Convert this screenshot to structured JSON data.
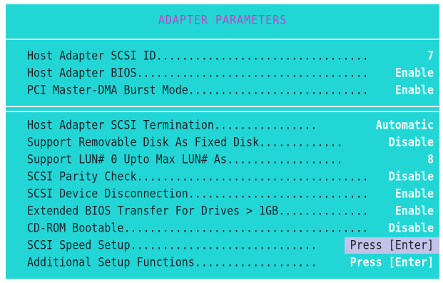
{
  "screen": {
    "title": "ADAPTER  PARAMETERS"
  },
  "colors": {
    "background": "#22d6d6",
    "title": "#c63ec6",
    "label_text": "#14242c",
    "value_text": "#ecffff",
    "selection": "#c3c3e9"
  },
  "group1": {
    "rows": [
      {
        "label": "Host Adapter SCSI ID.................................",
        "value": "7"
      },
      {
        "label": "Host Adapter BIOS....................................",
        "value": "Enable"
      },
      {
        "label": "PCI Master-DMA Burst Mode............................",
        "value": "Enable"
      }
    ]
  },
  "group2": {
    "rows": [
      {
        "label": "Host Adapter SCSI Termination................",
        "value": "Automatic"
      },
      {
        "label": "Support Removable Disk As Fixed Disk.............",
        "value": "Disable"
      },
      {
        "label": "Support LUN# 0 Upto Max LUN# As..................",
        "value": "8"
      },
      {
        "label": "SCSI Parity Check....................................",
        "value": "Disable"
      },
      {
        "label": "SCSI Device Disconnection............................",
        "value": "Enable"
      },
      {
        "label": "Extended BIOS Transfer For Drives > 1GB..............",
        "value": "Enable"
      },
      {
        "label": "CD-ROM Bootable......................................",
        "value": "Disable"
      },
      {
        "label": "SCSI Speed Setup.............................",
        "value": "Press [Enter]"
      },
      {
        "label": "Additional Setup Functions...................",
        "value": "Press [Enter]"
      }
    ]
  }
}
